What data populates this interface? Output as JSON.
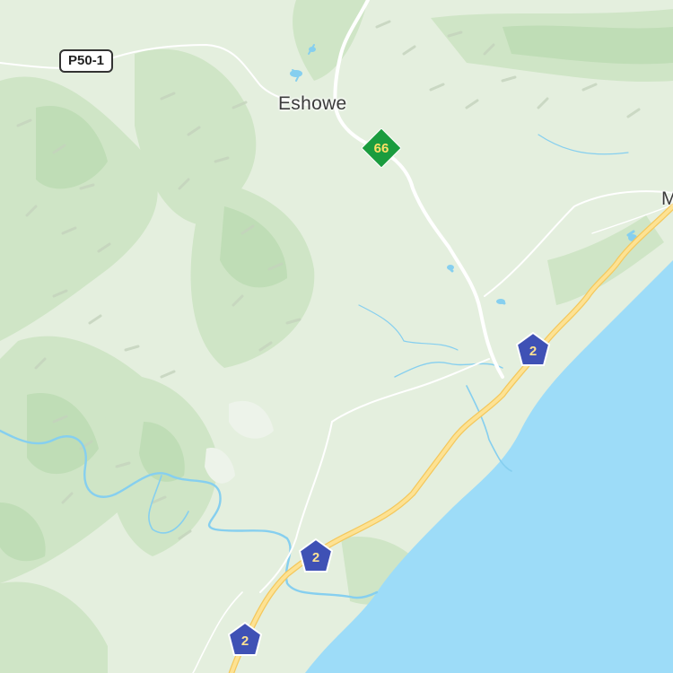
{
  "map": {
    "places": [
      {
        "name": "Eshowe"
      },
      {
        "name": "M"
      }
    ],
    "route_shields": {
      "p50_1": "P50-1",
      "r66": "66",
      "n2_a": "2",
      "n2_b": "2",
      "n2_c": "2"
    },
    "colors": {
      "land": "#e4efde",
      "vegetation": "#cfe5c6",
      "dense_vegetation": "#bfddb6",
      "terrain_shade": "#c7d3c2",
      "water": "#9ddcf8",
      "river": "#86cfef",
      "road_minor": "#ffffff",
      "highway": "#fde293",
      "highway_outline": "#f4c85c",
      "n2_shield": "#3f51b5",
      "n2_text": "#fde293",
      "r66_shield": "#1a9c3e",
      "r66_text": "#ffe066"
    }
  }
}
